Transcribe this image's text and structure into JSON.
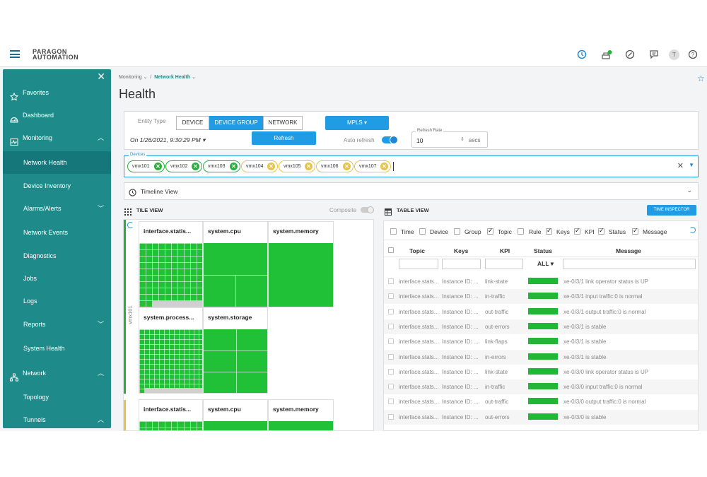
{
  "header": {
    "brand_line1": "PARAGON",
    "brand_line2": "AUTOMATION",
    "user_initial": "T"
  },
  "sidebar": {
    "items": [
      {
        "label": "Favorites",
        "icon": "star-icon"
      },
      {
        "label": "Dashboard",
        "icon": "dashboard-icon"
      },
      {
        "label": "Monitoring",
        "icon": "monitoring-icon"
      },
      {
        "label": "Network Health"
      },
      {
        "label": "Device Inventory"
      },
      {
        "label": "Alarms/Alerts"
      },
      {
        "label": "Network Events"
      },
      {
        "label": "Diagnostics"
      },
      {
        "label": "Jobs"
      },
      {
        "label": "Logs"
      },
      {
        "label": "Reports"
      },
      {
        "label": "System Health"
      },
      {
        "label": "Network",
        "icon": "network-icon"
      },
      {
        "label": "Topology"
      },
      {
        "label": "Tunnels"
      }
    ]
  },
  "breadcrumb": {
    "parent": "Monitoring",
    "current": "Network Health"
  },
  "page_title": "Health",
  "filters": {
    "entity_type_label": "Entity Type",
    "entity_types": [
      "DEVICE",
      "DEVICE GROUP",
      "NETWORK"
    ],
    "selected_entity": "DEVICE GROUP",
    "group_select": "MPLS",
    "date_text": "On 1/26/2021, 9:30:29 PM",
    "refresh_button": "Refresh",
    "auto_refresh_label": "Auto refresh",
    "refresh_rate_label": "Refresh Rate",
    "refresh_rate_value": "10",
    "refresh_rate_unit": "secs"
  },
  "devices": {
    "label": "Devices",
    "chips": [
      {
        "name": "vmx101",
        "status": "ok"
      },
      {
        "name": "vmx102",
        "status": "ok"
      },
      {
        "name": "vmx103",
        "status": "ok"
      },
      {
        "name": "vmx104",
        "status": "warn"
      },
      {
        "name": "vmx105",
        "status": "warn"
      },
      {
        "name": "vmx106",
        "status": "warn"
      },
      {
        "name": "vmx107",
        "status": "warn"
      }
    ]
  },
  "timeline": {
    "label": "Timeline View"
  },
  "tile_view": {
    "title": "TILE VIEW",
    "composite_label": "Composite",
    "row_device": "vmx101",
    "tiles_row1": [
      "interface.statis...",
      "system.cpu",
      "system.memory"
    ],
    "tiles_row2": [
      "system.process...",
      "system.storage"
    ],
    "tiles_row3": [
      "interface.statis...",
      "system.cpu",
      "system.memory"
    ]
  },
  "table_view": {
    "title": "TABLE VIEW",
    "time_inspector": "TIME INSPECTOR",
    "column_toggles": [
      {
        "label": "Time",
        "checked": false
      },
      {
        "label": "Device",
        "checked": false
      },
      {
        "label": "Group",
        "checked": false
      },
      {
        "label": "Topic",
        "checked": true
      },
      {
        "label": "Rule",
        "checked": false
      },
      {
        "label": "Keys",
        "checked": true
      },
      {
        "label": "KPI",
        "checked": true
      },
      {
        "label": "Status",
        "checked": true
      },
      {
        "label": "Message",
        "checked": true
      }
    ],
    "columns": [
      "Topic",
      "Keys",
      "KPI",
      "Status",
      "Message"
    ],
    "status_filter": "ALL",
    "status_color": "#20b636",
    "rows": [
      {
        "topic": "interface.stats...",
        "keys": "Instance ID: ...",
        "kpi": "link-state",
        "message": "xe-0/3/1 link operator status is UP"
      },
      {
        "topic": "interface.stats...",
        "keys": "Instance ID: ...",
        "kpi": "in-traffic",
        "message": "xe-0/3/1 input traffic:0 is normal"
      },
      {
        "topic": "interface.stats...",
        "keys": "Instance ID: ...",
        "kpi": "out-traffic",
        "message": "xe-0/3/1 output traffic:0 is normal"
      },
      {
        "topic": "interface.stats...",
        "keys": "Instance ID: ...",
        "kpi": "out-errors",
        "message": "xe-0/3/1 is stable"
      },
      {
        "topic": "interface.stats...",
        "keys": "Instance ID: ...",
        "kpi": "link-flaps",
        "message": "xe-0/3/1 is stable"
      },
      {
        "topic": "interface.stats...",
        "keys": "Instance ID: ...",
        "kpi": "in-errors",
        "message": "xe-0/3/1 is stable"
      },
      {
        "topic": "interface.stats...",
        "keys": "Instance ID: ...",
        "kpi": "link-state",
        "message": "xe-0/3/0 link operator status is UP"
      },
      {
        "topic": "interface.stats...",
        "keys": "Instance ID: ...",
        "kpi": "in-traffic",
        "message": "xe-0/3/0 input traffic:0 is normal"
      },
      {
        "topic": "interface.stats...",
        "keys": "Instance ID: ...",
        "kpi": "out-traffic",
        "message": "xe-0/3/0 output traffic:0 is normal"
      },
      {
        "topic": "interface.stats...",
        "keys": "Instance ID: ...",
        "kpi": "out-errors",
        "message": "xe-0/3/0 is stable"
      }
    ]
  }
}
